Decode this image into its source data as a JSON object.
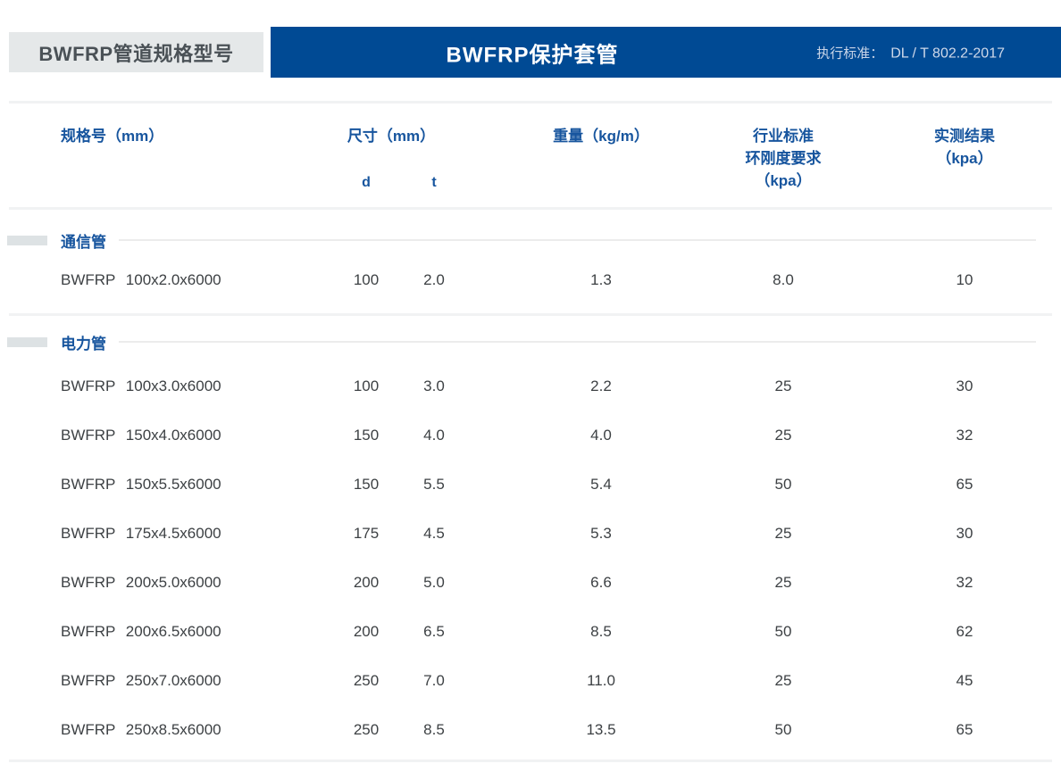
{
  "header": {
    "tag_label": "BWFRP管道规格型号",
    "banner_title": "BWFRP保护套管",
    "standard_label": "执行标准：",
    "standard_value": "DL / T 802.2-2017"
  },
  "colors": {
    "banner_blue": "#004a94",
    "header_text_blue": "#17559e",
    "tag_box_gray": "#e5e8e9",
    "divider_gray": "#f1f2f3",
    "data_text": "#3d4144"
  },
  "table": {
    "headers": {
      "spec": "规格号（mm）",
      "size": "尺寸（mm）",
      "size_d": "d",
      "size_t": "t",
      "weight": "重量（kg/m）",
      "ring_line1": "行业标准",
      "ring_line2": "环刚度要求",
      "ring_line3": "（kpa）",
      "result_line1": "实测结果",
      "result_line2": "（kpa）"
    },
    "sections": [
      {
        "name": "通信管",
        "rows": [
          {
            "model": "BWFRP 100x2.0x6000",
            "d": "100",
            "t": "2.0",
            "weight": "1.3",
            "ring": "8.0",
            "result": "10"
          }
        ]
      },
      {
        "name": "电力管",
        "rows": [
          {
            "model": "BWFRP 100x3.0x6000",
            "d": "100",
            "t": "3.0",
            "weight": "2.2",
            "ring": "25",
            "result": "30"
          },
          {
            "model": "BWFRP 150x4.0x6000",
            "d": "150",
            "t": "4.0",
            "weight": "4.0",
            "ring": "25",
            "result": "32"
          },
          {
            "model": "BWFRP 150x5.5x6000",
            "d": "150",
            "t": "5.5",
            "weight": "5.4",
            "ring": "50",
            "result": "65"
          },
          {
            "model": "BWFRP 175x4.5x6000",
            "d": "175",
            "t": "4.5",
            "weight": "5.3",
            "ring": "25",
            "result": "30"
          },
          {
            "model": "BWFRP 200x5.0x6000",
            "d": "200",
            "t": "5.0",
            "weight": "6.6",
            "ring": "25",
            "result": "32"
          },
          {
            "model": "BWFRP 200x6.5x6000",
            "d": "200",
            "t": "6.5",
            "weight": "8.5",
            "ring": "50",
            "result": "62"
          },
          {
            "model": "BWFRP 250x7.0x6000",
            "d": "250",
            "t": "7.0",
            "weight": "11.0",
            "ring": "25",
            "result": "45"
          },
          {
            "model": "BWFRP 250x8.5x6000",
            "d": "250",
            "t": "8.5",
            "weight": "13.5",
            "ring": "50",
            "result": "65"
          }
        ]
      }
    ]
  }
}
